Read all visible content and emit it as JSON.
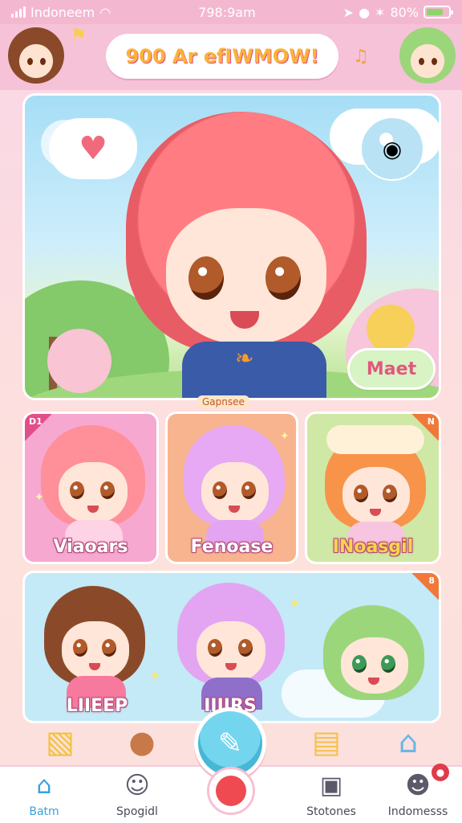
{
  "status_bar": {
    "carrier": "Indoneem",
    "time": "798:9am",
    "battery": "80%",
    "battery_level": 0.8,
    "icons": [
      "signal-icon",
      "wifi-icon",
      "location-icon",
      "alarm-icon",
      "bluetooth-icon",
      "battery-icon"
    ]
  },
  "header": {
    "title": "900 Ar efIWMOW!",
    "left_avatar": "avatar-brown-hair",
    "right_avatar": "avatar-green-hair",
    "icons": [
      "ribbon-icon",
      "bell-icon"
    ]
  },
  "hero": {
    "button_label": "Maet",
    "caption": "Gapnsee",
    "colors": {
      "hair": "#ff7d82",
      "sky": "#a6def6",
      "button_bg": "#d8f3c4",
      "button_text": "#e2587d"
    }
  },
  "cards_row1": [
    {
      "label": "Viaoars",
      "badge": "D1",
      "bg": "#f6a8d0",
      "hair": "#ff8f99"
    },
    {
      "label": "Fenoase",
      "badge": "",
      "bg": "#f7b48e",
      "hair": "#e7a9f3"
    },
    {
      "label": "INoasgil",
      "badge": "N",
      "bg": "#cfe8a6",
      "hair": "#f7944a"
    }
  ],
  "cards_row2": {
    "bg": "#c4e9f7",
    "badge": "8",
    "characters": [
      {
        "label": "LIIEEP",
        "hair": "#8a4a2a"
      },
      {
        "label": "IIIIRS",
        "hair": "#e3a5f2"
      },
      {
        "label": "",
        "hair": "#9cd67a"
      }
    ]
  },
  "strip_icons": [
    "book-icon",
    "bear-icon",
    "gift-box-icon",
    "house-icon"
  ],
  "fab_icon": "pencil-icon",
  "record_icon": "record-icon",
  "bottom_nav": [
    {
      "label": "Batm",
      "icon": "home-icon",
      "active": true
    },
    {
      "label": "Spogidl",
      "icon": "character-icon",
      "active": false
    },
    {
      "label": "Stotones",
      "icon": "frame-icon",
      "active": false
    },
    {
      "label": "Indomesss",
      "icon": "profile-icon",
      "active": false
    }
  ]
}
